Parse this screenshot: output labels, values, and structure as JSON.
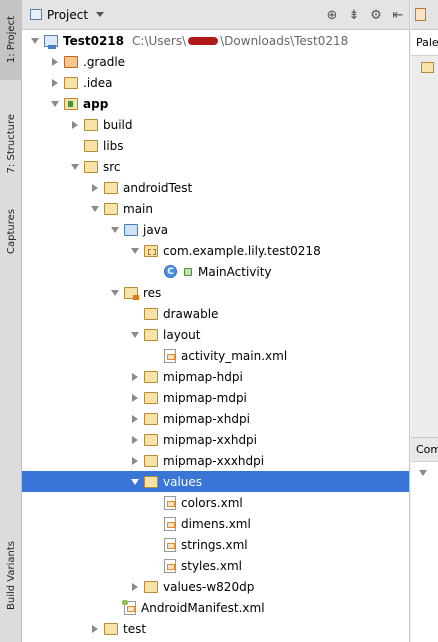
{
  "left_strip": {
    "tabs": [
      {
        "label": "1: Project",
        "active": true
      },
      {
        "label": "7: Structure"
      },
      {
        "label": "Captures"
      },
      {
        "label": "Build Variants"
      }
    ]
  },
  "panel": {
    "title": "Project",
    "tools": [
      "target-icon",
      "collapse-icon",
      "gear-icon",
      "hide-icon"
    ]
  },
  "tree": [
    {
      "label": "Test0218",
      "bold": true,
      "path_prefix": "C:\\Users\\",
      "path_suffix": "\\Downloads\\Test0218",
      "icon": "module",
      "state": "open",
      "indent": 0
    },
    {
      "label": ".gradle",
      "icon": "folder-orange",
      "state": "closed",
      "indent": 1
    },
    {
      "label": ".idea",
      "icon": "folder",
      "state": "closed",
      "indent": 1
    },
    {
      "label": "app",
      "bold": true,
      "icon": "folder-mod",
      "state": "open",
      "indent": 1
    },
    {
      "label": "build",
      "icon": "folder",
      "state": "closed",
      "indent": 2
    },
    {
      "label": "libs",
      "icon": "folder",
      "state": "none",
      "indent": 2
    },
    {
      "label": "src",
      "icon": "folder",
      "state": "open",
      "indent": 2
    },
    {
      "label": "androidTest",
      "icon": "folder",
      "state": "closed",
      "indent": 3
    },
    {
      "label": "main",
      "icon": "folder",
      "state": "open",
      "indent": 3
    },
    {
      "label": "java",
      "icon": "folder-blue",
      "state": "open",
      "indent": 4
    },
    {
      "label": "com.example.lily.test0218",
      "icon": "folder-pkg",
      "state": "open",
      "indent": 5
    },
    {
      "label": "MainActivity",
      "icon": "class",
      "state": "none",
      "indent": 6
    },
    {
      "label": "res",
      "icon": "folder-res",
      "state": "open",
      "indent": 4
    },
    {
      "label": "drawable",
      "icon": "folder",
      "state": "none",
      "indent": 5
    },
    {
      "label": "layout",
      "icon": "folder",
      "state": "open",
      "indent": 5
    },
    {
      "label": "activity_main.xml",
      "icon": "xml",
      "state": "none",
      "indent": 6
    },
    {
      "label": "mipmap-hdpi",
      "icon": "folder",
      "state": "closed",
      "indent": 5
    },
    {
      "label": "mipmap-mdpi",
      "icon": "folder",
      "state": "closed",
      "indent": 5
    },
    {
      "label": "mipmap-xhdpi",
      "icon": "folder",
      "state": "closed",
      "indent": 5
    },
    {
      "label": "mipmap-xxhdpi",
      "icon": "folder",
      "state": "closed",
      "indent": 5
    },
    {
      "label": "mipmap-xxxhdpi",
      "icon": "folder",
      "state": "closed",
      "indent": 5
    },
    {
      "label": "values",
      "icon": "folder",
      "state": "open",
      "indent": 5,
      "selected": true
    },
    {
      "label": "colors.xml",
      "icon": "xml",
      "state": "none",
      "indent": 6
    },
    {
      "label": "dimens.xml",
      "icon": "xml",
      "state": "none",
      "indent": 6
    },
    {
      "label": "strings.xml",
      "icon": "xml",
      "state": "none",
      "indent": 6
    },
    {
      "label": "styles.xml",
      "icon": "xml",
      "state": "none",
      "indent": 6
    },
    {
      "label": "values-w820dp",
      "icon": "folder",
      "state": "closed",
      "indent": 5
    },
    {
      "label": "AndroidManifest.xml",
      "icon": "xml-manifest",
      "state": "none",
      "indent": 4
    },
    {
      "label": "test",
      "icon": "folder",
      "state": "closed",
      "indent": 3
    }
  ],
  "right": {
    "palette_label": "Pale",
    "component_label": "Com"
  },
  "colors": {
    "selection": "#3875d7",
    "panel_bg": "#ffffff",
    "strip_bg": "#dcdcdc"
  }
}
